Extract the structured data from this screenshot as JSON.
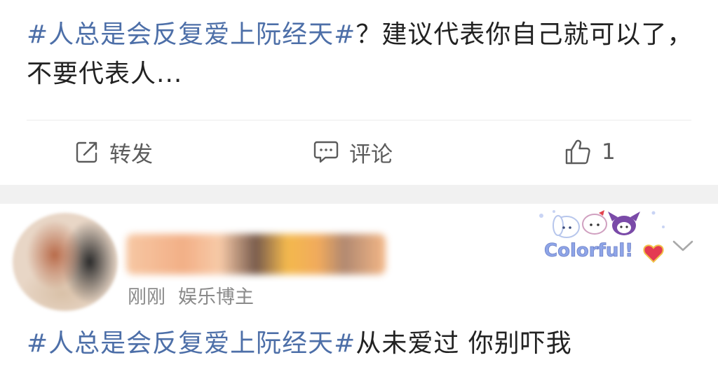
{
  "post1": {
    "hashtag": "#人总是会反复爱上阮经天#",
    "body": "？建议代表你自己就可以了，不要代表人..."
  },
  "actions": {
    "forward_label": "转发",
    "comment_label": "评论",
    "like_count": "1"
  },
  "post2": {
    "meta_time": "刚刚",
    "meta_role": "娱乐博主",
    "badge_text": "Colorful!",
    "hashtag": "#人总是会反复爱上阮经天#",
    "body": "从未爱过 你别吓我"
  },
  "colors": {
    "hashtag": "#4d6fa8",
    "text": "#222222",
    "meta": "#8a8a8a",
    "action": "#5b5b5b",
    "band": "#f1f1f1"
  },
  "icons": [
    "forward-icon",
    "comment-icon",
    "like-icon",
    "chevron-down-icon"
  ]
}
